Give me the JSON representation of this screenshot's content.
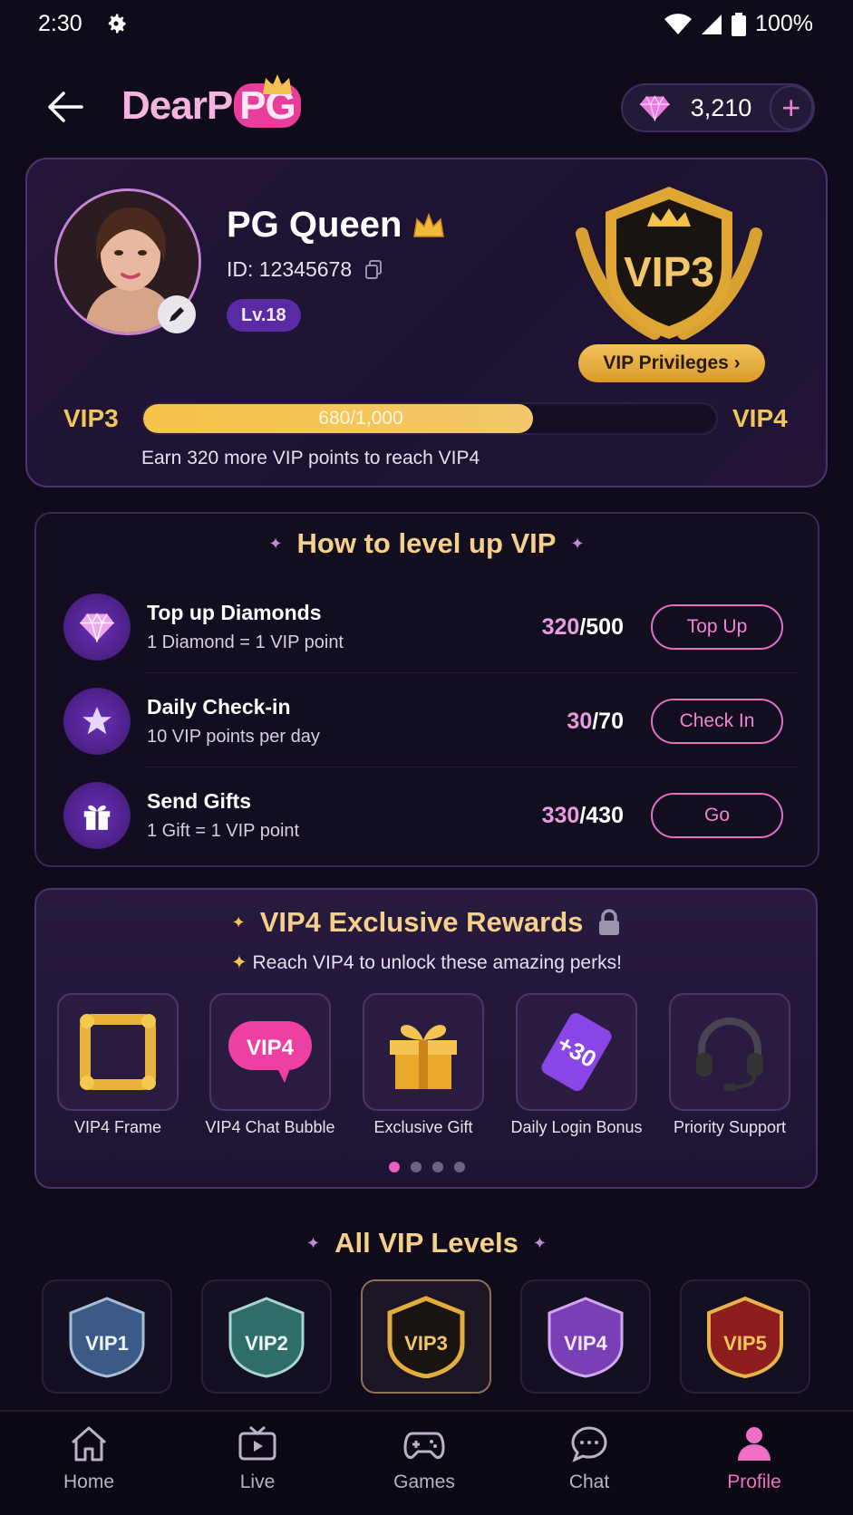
{
  "status_bar": {
    "time": "2:30",
    "battery": "100%"
  },
  "header": {
    "logo_main": "DearP",
    "logo_badge": "PG",
    "diamond_balance": "3,210",
    "add_label": "+"
  },
  "profile": {
    "name": "PG Queen",
    "id": "ID: 12345678",
    "level": "Lv.18",
    "vip_badge": "VIP3",
    "privileges_button": "VIP Privileges ›",
    "current_vip": "VIP3",
    "next_vip": "VIP4",
    "progress_text": "680/1,000",
    "progress_fraction": 0.68,
    "earn_text": "Earn 320 more VIP points to reach VIP4"
  },
  "level_up": {
    "title": "How to level up VIP",
    "tasks": [
      {
        "title": "Top up Diamonds",
        "subtitle": "1 Diamond = 1 VIP point",
        "done": "320",
        "total": "/500",
        "button": "Top Up",
        "icon": "diamond-icon"
      },
      {
        "title": "Daily Check-in",
        "subtitle": "10 VIP points per day",
        "done": "30",
        "total": "/70",
        "button": "Check In",
        "icon": "star-icon"
      },
      {
        "title": "Send Gifts",
        "subtitle": "1 Gift = 1 VIP point",
        "done": "330",
        "total": "/430",
        "button": "Go",
        "icon": "gift-icon"
      }
    ]
  },
  "rewards": {
    "title": "VIP4 Exclusive Rewards",
    "subtitle": "Reach VIP4 to unlock these amazing perks!",
    "items": [
      {
        "label": "VIP4 Frame",
        "icon": "frame-icon"
      },
      {
        "label": "VIP4 Chat Bubble",
        "icon": "chat-bubble-icon",
        "text": "VIP4"
      },
      {
        "label": "Exclusive Gift",
        "icon": "gift-box-icon"
      },
      {
        "label": "Daily Login Bonus",
        "icon": "bonus-card-icon",
        "text": "+30"
      },
      {
        "label": "Priority Support",
        "icon": "headset-icon"
      }
    ],
    "pages": 4,
    "active_page": 1
  },
  "all_levels": {
    "title": "All VIP Levels",
    "levels": [
      {
        "label": "VIP1",
        "color": "#3c5a86"
      },
      {
        "label": "VIP2",
        "color": "#2f6e68"
      },
      {
        "label": "VIP3",
        "color": "#d6a23a"
      },
      {
        "label": "VIP4",
        "color": "#7a3fb5"
      },
      {
        "label": "VIP5",
        "color": "#8e1e1e"
      }
    ],
    "active": "VIP3"
  },
  "nav": {
    "items": [
      {
        "label": "Home",
        "icon": "home-icon"
      },
      {
        "label": "Live",
        "icon": "tv-icon"
      },
      {
        "label": "Games",
        "icon": "gamepad-icon"
      },
      {
        "label": "Chat",
        "icon": "chat-icon"
      },
      {
        "label": "Profile",
        "icon": "profile-icon"
      }
    ],
    "active": "Profile"
  },
  "colors": {
    "accent_pink": "#ef6fc7",
    "gold": "#f2c55b",
    "background": "#0f0b1a"
  }
}
